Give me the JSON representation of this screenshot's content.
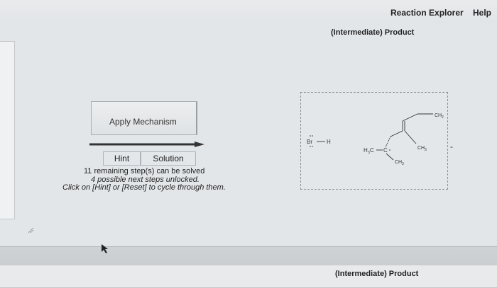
{
  "menu": {
    "reaction_explorer": "Reaction Explorer",
    "help": "Help"
  },
  "product_heading": "(Intermediate) Product",
  "apply_mechanism_label": "Apply Mechanism",
  "tabs": {
    "hint": "Hint",
    "solution": "Solution"
  },
  "info": {
    "remaining": "11 remaining step(s) can be solved",
    "unlocked": "4 possible next steps unlocked.",
    "instruction": "Click on [Hint] or [Reset] to cycle through them."
  },
  "molecules": {
    "hbr_br": "Br",
    "hbr_h": "H",
    "ch3_top": "CH",
    "ch3_right": "CH",
    "ch3_bottom": "CH",
    "h3c_left": "H",
    "h3c_c": "C",
    "carbocation_c": "C",
    "subscript_2": "2",
    "subscript_3": "3"
  },
  "minus_sign": "-",
  "bottom_heading": "(Intermediate) Product",
  "colors": {
    "background": "#e3e6e9",
    "text": "#222222",
    "button_bg": "#e4e7ea",
    "border": "#a9adb1"
  },
  "icons": {
    "cursor": "mouse-pointer-icon",
    "resize": "resize-grip-icon",
    "arrow": "reaction-arrow-icon"
  }
}
